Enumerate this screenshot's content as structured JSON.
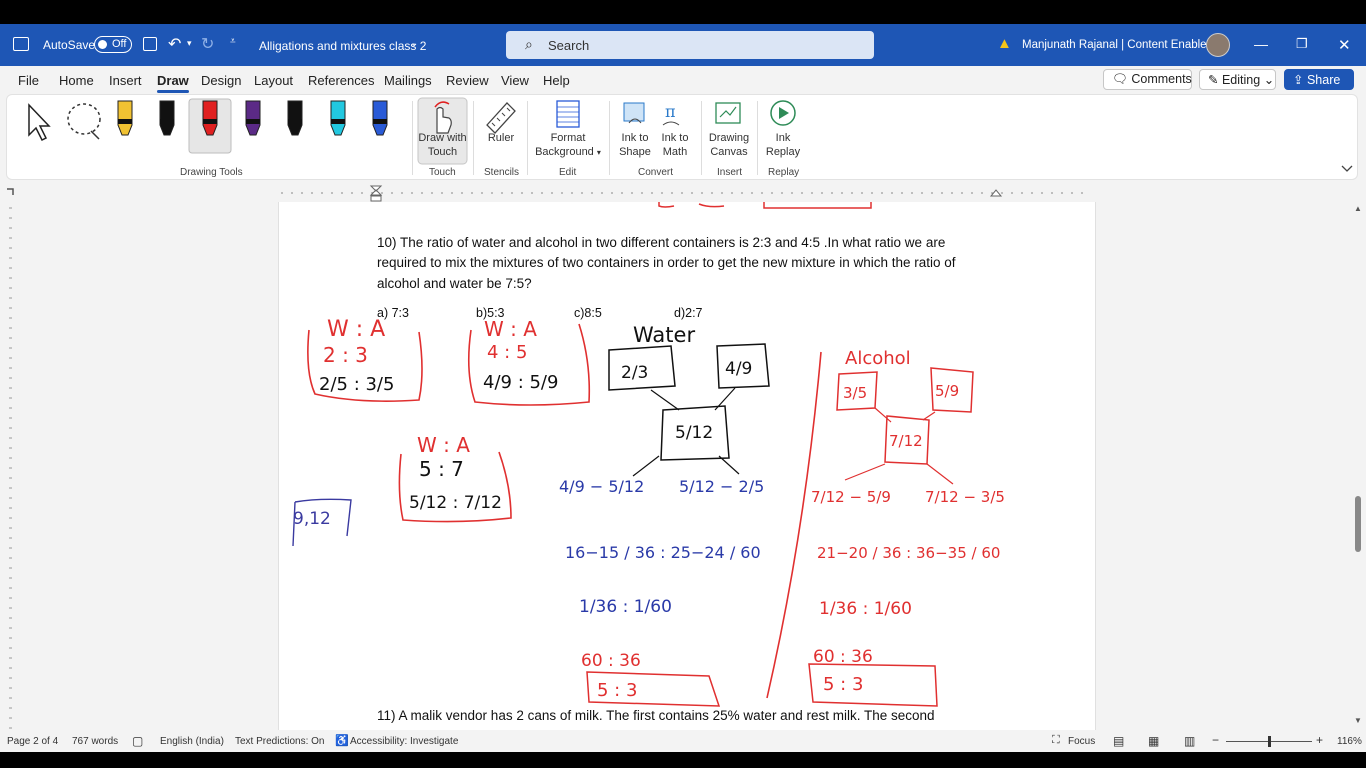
{
  "titlebar": {
    "autosave_label": "AutoSave",
    "autosave_state": "Off",
    "doc_title": "Alligations and mixtures class 2",
    "search_placeholder": "Search",
    "user_name": "Manjunath Rajanal | Content Enablers"
  },
  "menu": {
    "tabs": [
      "File",
      "Home",
      "Insert",
      "Draw",
      "Design",
      "Layout",
      "References",
      "Mailings",
      "Review",
      "View",
      "Help"
    ],
    "active_tab": "Draw",
    "comments_label": "Comments",
    "editing_label": "Editing",
    "share_label": "Share"
  },
  "ribbon": {
    "groups": {
      "drawing_tools": "Drawing Tools",
      "touch": "Touch",
      "stencils": "Stencils",
      "edit": "Edit",
      "convert": "Convert",
      "insert": "Insert",
      "replay": "Replay"
    },
    "buttons": {
      "draw_with_touch": "Draw with Touch",
      "ruler": "Ruler",
      "format_background": "Format Background",
      "ink_to_shape": "Ink to Shape",
      "ink_to_math": "Ink to Math",
      "drawing_canvas": "Drawing Canvas",
      "ink_replay": "Ink Replay"
    },
    "pen_colors": [
      "#f1c232",
      "#111111",
      "#e02020",
      "#5b2a86",
      "#111111",
      "#22c8e0",
      "#2a5bd7"
    ]
  },
  "document": {
    "q10_line1": "10) The ratio of water and alcohol in two different containers is 2:3 and 4:5 .In what ratio we are",
    "q10_line2": "required to mix the mixtures of two containers in order to get the new mixture in which the ratio of",
    "q10_line3": "alcohol and water be 7:5?",
    "opt_a": "a) 7:3",
    "opt_b": "b)5:3",
    "opt_c": "c)8:5",
    "opt_d": "d)2:7",
    "q11_line1": "11) A malik vendor has 2 cans of milk. The first contains 25% water and rest milk. The second"
  },
  "ink_notes": {
    "water": "Water",
    "alcohol": "Alcohol",
    "wa1": "W : A",
    "r1a": "2 : 3",
    "f1": "2/5 : 3/5",
    "wa2": "W : A",
    "r2a": "4 : 5",
    "f2": "4/9 : 5/9",
    "wa3": "W : A",
    "r3": "5 : 7",
    "f3": "5/12 : 7/12",
    "lcm": "9,12",
    "w_top_left": "2/3",
    "w_top_right": "4/9",
    "w_center": "5/12",
    "w_diff_left": "4/9 − 5/12",
    "w_diff_right": "5/12 − 2/5",
    "w_step1": "16−15 / 36 : 25−24 / 60",
    "w_step2": "1/36 : 1/60",
    "w_step3": "60 : 36",
    "w_ans": "5 : 3",
    "a_top_left": "3/5",
    "a_top_right": "5/9",
    "a_center": "7/12",
    "a_diff_left": "7/12 − 5/9",
    "a_diff_right": "7/12 − 3/5",
    "a_step1": "21−20 / 36 : 36−35 / 60",
    "a_step2": "1/36 : 1/60",
    "a_step3": "60 : 36",
    "a_ans": "5 : 3"
  },
  "status": {
    "page": "Page 2 of 4",
    "words": "767 words",
    "language": "English (India)",
    "predictions": "Text Predictions: On",
    "accessibility": "Accessibility: Investigate",
    "focus": "Focus",
    "zoom": "116%"
  }
}
